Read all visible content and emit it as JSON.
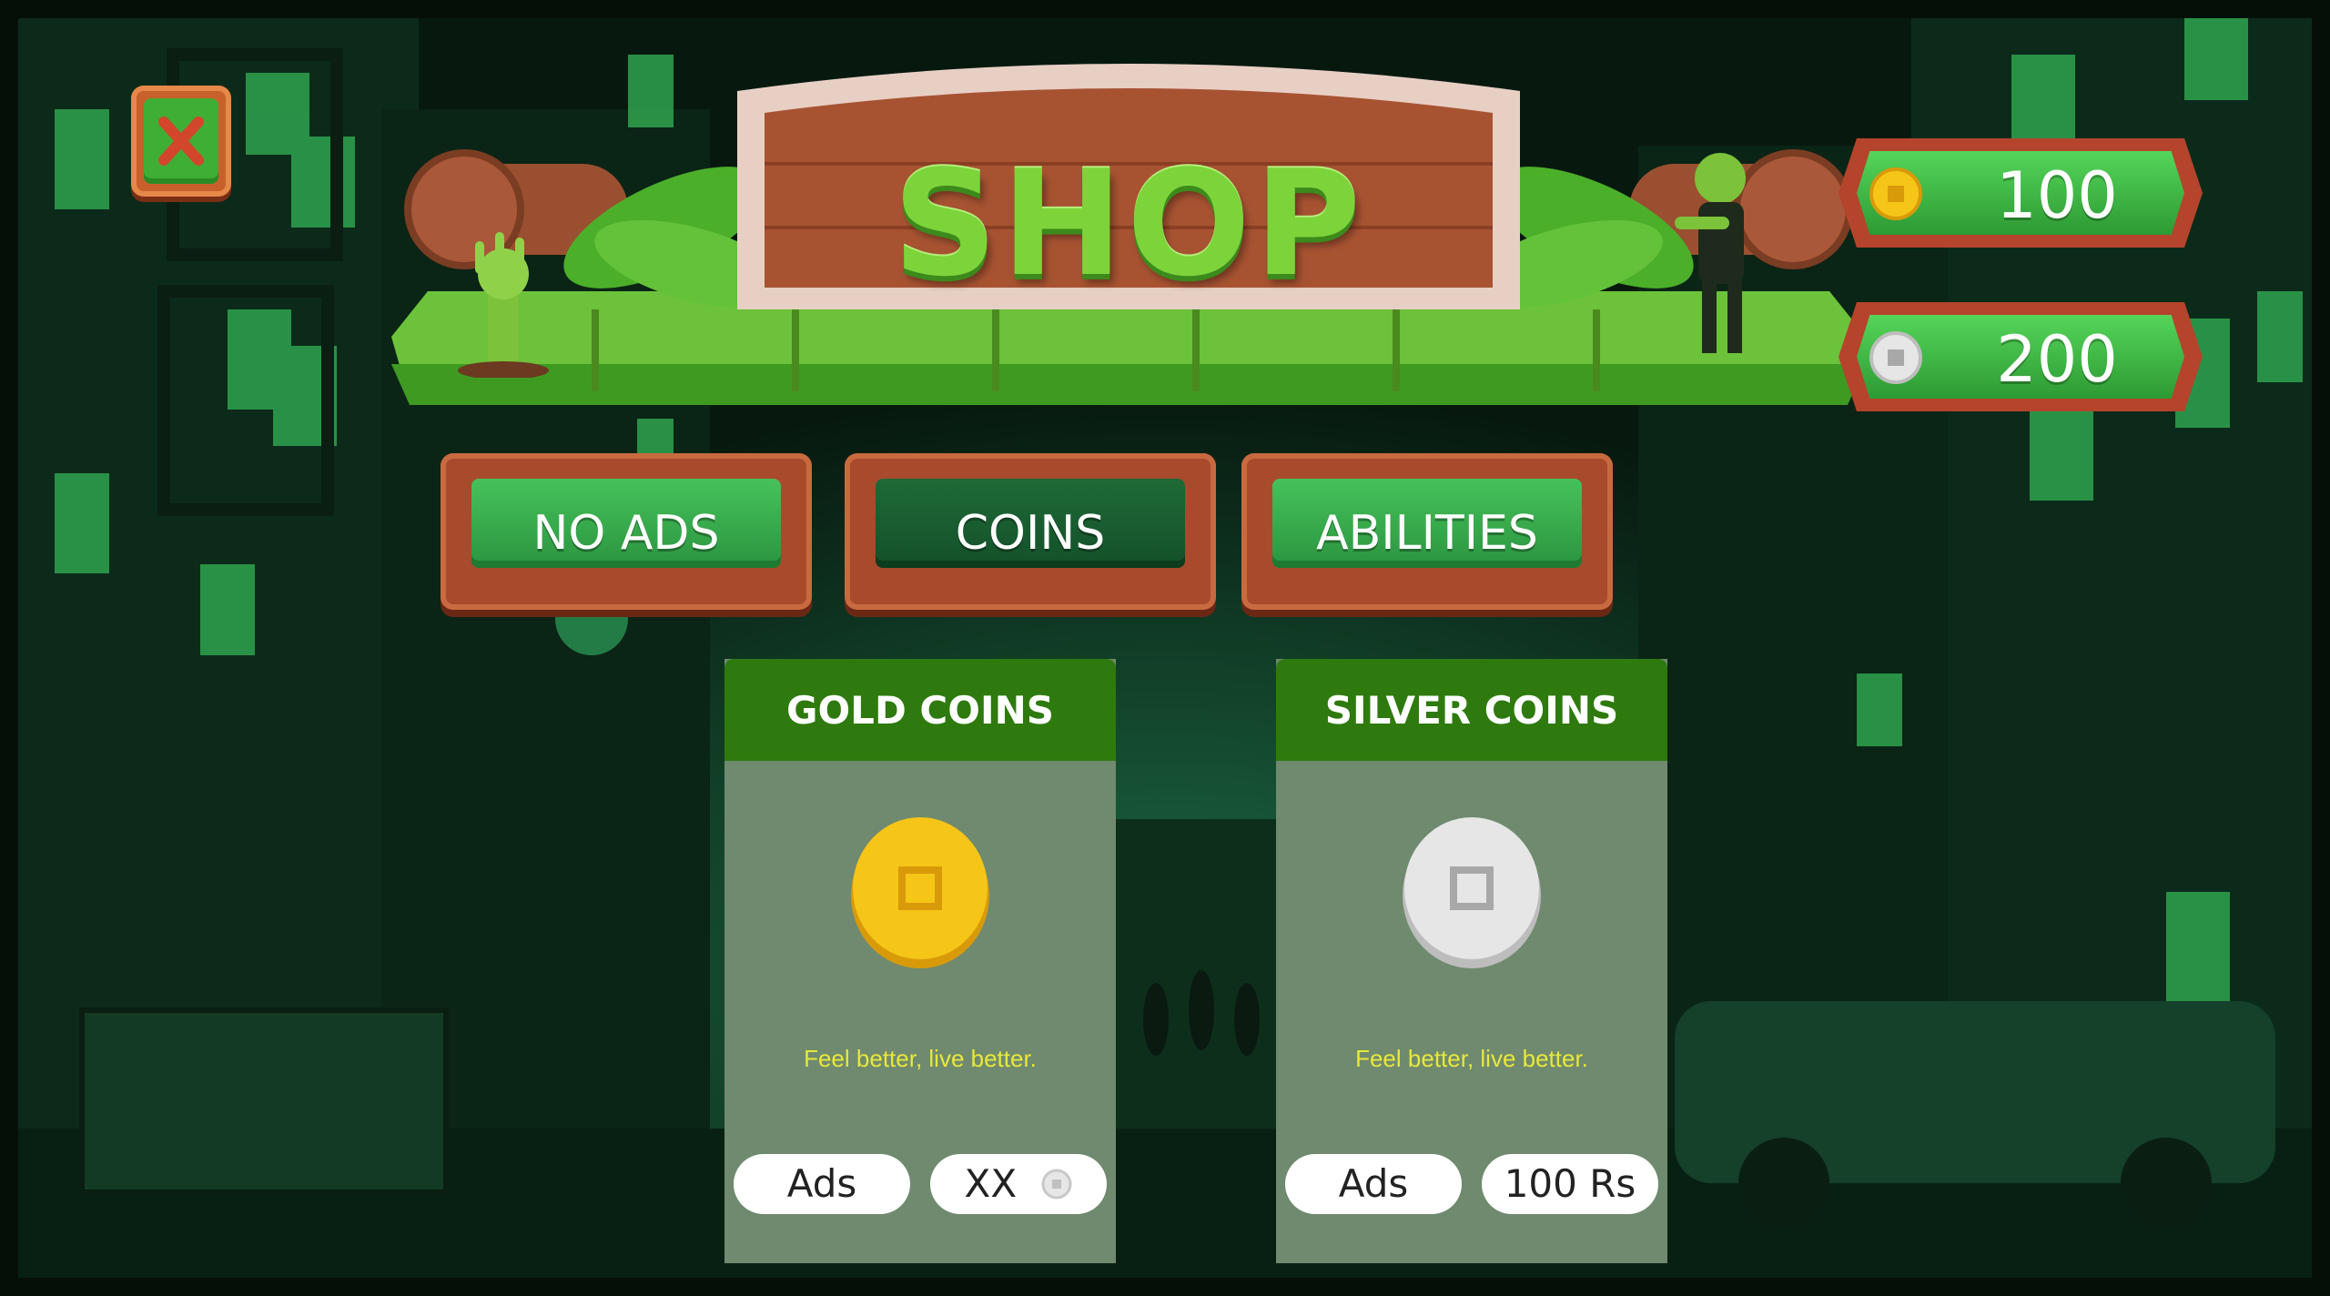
{
  "shop": {
    "title": "SHOP"
  },
  "currency": {
    "gold_amount": "100",
    "silver_amount": "200"
  },
  "tabs": [
    {
      "label": "NO ADS",
      "active": false
    },
    {
      "label": "COINS",
      "active": true
    },
    {
      "label": "ABILITIES",
      "active": false
    }
  ],
  "cards": [
    {
      "title": "GOLD COINS",
      "description": "Feel better, live better.",
      "ads_label": "Ads",
      "price_label": "XX"
    },
    {
      "title": "SILVER COINS",
      "description": "Feel better, live better.",
      "ads_label": "Ads",
      "price_label": "100 Rs"
    }
  ],
  "colors": {
    "gold_coin": "#f5c518",
    "silver_coin": "#dcdcdc",
    "card_body": "#6f8a6e",
    "card_header": "#2e7a0e",
    "tab_green": "#3bb04e",
    "tab_active": "#1a5c30",
    "wood": "#a84a2c"
  },
  "icons": {
    "close": "close-x-icon",
    "gold": "gold-coin-icon",
    "silver": "silver-coin-icon",
    "zombie_hand": "zombie-hand-icon",
    "zombie": "zombie-figure-icon"
  }
}
